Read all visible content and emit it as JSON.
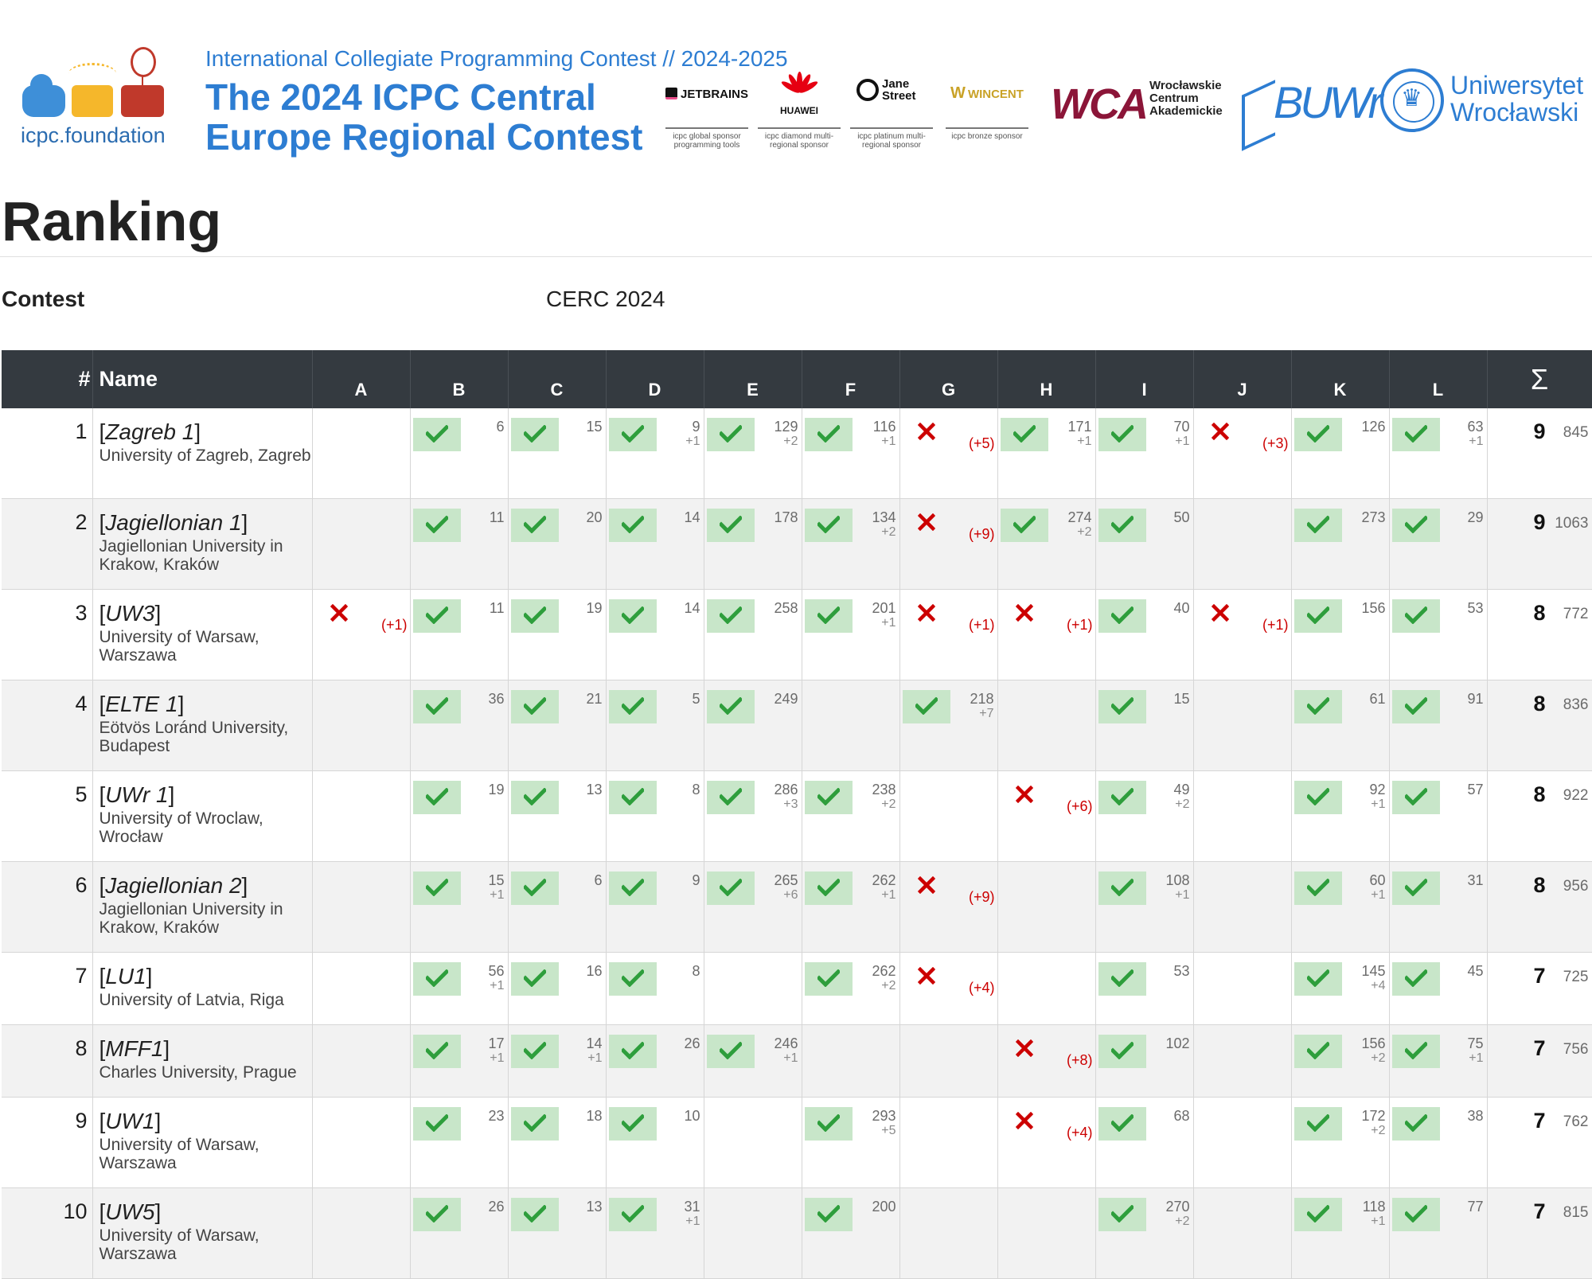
{
  "banner": {
    "foundation_name": "icpc.foundation",
    "subtitle": "International Collegiate Programming Contest // 2024-2025",
    "title_line1": "The 2024 ICPC Central",
    "title_line2": "Europe Regional Contest",
    "sponsors": [
      {
        "name": "JETBRAINS",
        "role": "icpc global sponsor programming tools"
      },
      {
        "name": "HUAWEI",
        "role": "icpc diamond multi-regional sponsor"
      },
      {
        "name": "Jane Street",
        "role": "icpc platinum multi-regional sponsor"
      },
      {
        "name": "WINCENT",
        "role": "icpc bronze sponsor"
      }
    ],
    "wca_mark": "WCA",
    "wca_text": "Wrocławskie Centrum Akademickie",
    "buwr_mark": "BUWr",
    "university_name": "Uniwersytet Wrocławski"
  },
  "page": {
    "title": "Ranking",
    "contest_label": "Contest",
    "contest_value": "CERC 2024"
  },
  "table": {
    "headers": {
      "rank": "#",
      "name": "Name",
      "sum": "Σ"
    },
    "problems": [
      "A",
      "B",
      "C",
      "D",
      "E",
      "F",
      "G",
      "H",
      "I",
      "J",
      "K",
      "L"
    ],
    "colors": {
      "header_bg": "#343a40",
      "solved_bg": "#c8e6c9",
      "check": "#2e9e3c",
      "fail": "#cc0000"
    },
    "rows": [
      {
        "rank": "1",
        "team": "Zagreb 1",
        "university": "University of Zagreb, Zagreb",
        "solved": "9",
        "total": "845",
        "results": [
          null,
          {
            "s": "ok",
            "t": "6"
          },
          {
            "s": "ok",
            "t": "15"
          },
          {
            "s": "ok",
            "t": "9",
            "p": "+1"
          },
          {
            "s": "ok",
            "t": "129",
            "p": "+2"
          },
          {
            "s": "ok",
            "t": "116",
            "p": "+1"
          },
          {
            "s": "bad",
            "a": "(+5)"
          },
          {
            "s": "ok",
            "t": "171",
            "p": "+1"
          },
          {
            "s": "ok",
            "t": "70",
            "p": "+1"
          },
          {
            "s": "bad",
            "a": "(+3)"
          },
          {
            "s": "ok",
            "t": "126"
          },
          {
            "s": "ok",
            "t": "63",
            "p": "+1"
          }
        ]
      },
      {
        "rank": "2",
        "team": "Jagiellonian 1",
        "university": "Jagiellonian University in Krakow, Kraków",
        "solved": "9",
        "total": "1063",
        "results": [
          null,
          {
            "s": "ok",
            "t": "11"
          },
          {
            "s": "ok",
            "t": "20"
          },
          {
            "s": "ok",
            "t": "14"
          },
          {
            "s": "ok",
            "t": "178"
          },
          {
            "s": "ok",
            "t": "134",
            "p": "+2"
          },
          {
            "s": "bad",
            "a": "(+9)"
          },
          {
            "s": "ok",
            "t": "274",
            "p": "+2"
          },
          {
            "s": "ok",
            "t": "50"
          },
          null,
          {
            "s": "ok",
            "t": "273"
          },
          {
            "s": "ok",
            "t": "29"
          }
        ]
      },
      {
        "rank": "3",
        "team": "UW3",
        "university": "University of Warsaw, Warszawa",
        "solved": "8",
        "total": "772",
        "results": [
          {
            "s": "bad",
            "a": "(+1)"
          },
          {
            "s": "ok",
            "t": "11"
          },
          {
            "s": "ok",
            "t": "19"
          },
          {
            "s": "ok",
            "t": "14"
          },
          {
            "s": "ok",
            "t": "258"
          },
          {
            "s": "ok",
            "t": "201",
            "p": "+1"
          },
          {
            "s": "bad",
            "a": "(+1)"
          },
          {
            "s": "bad",
            "a": "(+1)"
          },
          {
            "s": "ok",
            "t": "40"
          },
          {
            "s": "bad",
            "a": "(+1)"
          },
          {
            "s": "ok",
            "t": "156"
          },
          {
            "s": "ok",
            "t": "53"
          }
        ]
      },
      {
        "rank": "4",
        "team": "ELTE 1",
        "university": "Eötvös Loránd University, Budapest",
        "solved": "8",
        "total": "836",
        "results": [
          null,
          {
            "s": "ok",
            "t": "36"
          },
          {
            "s": "ok",
            "t": "21"
          },
          {
            "s": "ok",
            "t": "5"
          },
          {
            "s": "ok",
            "t": "249"
          },
          null,
          {
            "s": "ok",
            "t": "218",
            "p": "+7"
          },
          null,
          {
            "s": "ok",
            "t": "15"
          },
          null,
          {
            "s": "ok",
            "t": "61"
          },
          {
            "s": "ok",
            "t": "91"
          }
        ]
      },
      {
        "rank": "5",
        "team": "UWr 1",
        "university": "University of Wroclaw, Wrocław",
        "solved": "8",
        "total": "922",
        "results": [
          null,
          {
            "s": "ok",
            "t": "19"
          },
          {
            "s": "ok",
            "t": "13"
          },
          {
            "s": "ok",
            "t": "8"
          },
          {
            "s": "ok",
            "t": "286",
            "p": "+3"
          },
          {
            "s": "ok",
            "t": "238",
            "p": "+2"
          },
          null,
          {
            "s": "bad",
            "a": "(+6)"
          },
          {
            "s": "ok",
            "t": "49",
            "p": "+2"
          },
          null,
          {
            "s": "ok",
            "t": "92",
            "p": "+1"
          },
          {
            "s": "ok",
            "t": "57"
          }
        ]
      },
      {
        "rank": "6",
        "team": "Jagiellonian 2",
        "university": "Jagiellonian University in Krakow, Kraków",
        "solved": "8",
        "total": "956",
        "results": [
          null,
          {
            "s": "ok",
            "t": "15",
            "p": "+1"
          },
          {
            "s": "ok",
            "t": "6"
          },
          {
            "s": "ok",
            "t": "9"
          },
          {
            "s": "ok",
            "t": "265",
            "p": "+6"
          },
          {
            "s": "ok",
            "t": "262",
            "p": "+1"
          },
          {
            "s": "bad",
            "a": "(+9)"
          },
          null,
          {
            "s": "ok",
            "t": "108",
            "p": "+1"
          },
          null,
          {
            "s": "ok",
            "t": "60",
            "p": "+1"
          },
          {
            "s": "ok",
            "t": "31"
          }
        ]
      },
      {
        "rank": "7",
        "team": "LU1",
        "university": "University of Latvia, Riga",
        "solved": "7",
        "total": "725",
        "short": true,
        "results": [
          null,
          {
            "s": "ok",
            "t": "56",
            "p": "+1"
          },
          {
            "s": "ok",
            "t": "16"
          },
          {
            "s": "ok",
            "t": "8"
          },
          null,
          {
            "s": "ok",
            "t": "262",
            "p": "+2"
          },
          {
            "s": "bad",
            "a": "(+4)"
          },
          null,
          {
            "s": "ok",
            "t": "53"
          },
          null,
          {
            "s": "ok",
            "t": "145",
            "p": "+4"
          },
          {
            "s": "ok",
            "t": "45"
          }
        ]
      },
      {
        "rank": "8",
        "team": "MFF1",
        "university": "Charles University, Prague",
        "solved": "7",
        "total": "756",
        "short": true,
        "results": [
          null,
          {
            "s": "ok",
            "t": "17",
            "p": "+1"
          },
          {
            "s": "ok",
            "t": "14",
            "p": "+1"
          },
          {
            "s": "ok",
            "t": "26"
          },
          {
            "s": "ok",
            "t": "246",
            "p": "+1"
          },
          null,
          null,
          {
            "s": "bad",
            "a": "(+8)"
          },
          {
            "s": "ok",
            "t": "102"
          },
          null,
          {
            "s": "ok",
            "t": "156",
            "p": "+2"
          },
          {
            "s": "ok",
            "t": "75",
            "p": "+1"
          }
        ]
      },
      {
        "rank": "9",
        "team": "UW1",
        "university": "University of Warsaw, Warszawa",
        "solved": "7",
        "total": "762",
        "results": [
          null,
          {
            "s": "ok",
            "t": "23"
          },
          {
            "s": "ok",
            "t": "18"
          },
          {
            "s": "ok",
            "t": "10"
          },
          null,
          {
            "s": "ok",
            "t": "293",
            "p": "+5"
          },
          null,
          {
            "s": "bad",
            "a": "(+4)"
          },
          {
            "s": "ok",
            "t": "68"
          },
          null,
          {
            "s": "ok",
            "t": "172",
            "p": "+2"
          },
          {
            "s": "ok",
            "t": "38"
          }
        ]
      },
      {
        "rank": "10",
        "team": "UW5",
        "university": "University of Warsaw, Warszawa",
        "solved": "7",
        "total": "815",
        "results": [
          null,
          {
            "s": "ok",
            "t": "26"
          },
          {
            "s": "ok",
            "t": "13"
          },
          {
            "s": "ok",
            "t": "31",
            "p": "+1"
          },
          null,
          {
            "s": "ok",
            "t": "200"
          },
          null,
          null,
          {
            "s": "ok",
            "t": "270",
            "p": "+2"
          },
          null,
          {
            "s": "ok",
            "t": "118",
            "p": "+1"
          },
          {
            "s": "ok",
            "t": "77"
          }
        ]
      }
    ]
  }
}
